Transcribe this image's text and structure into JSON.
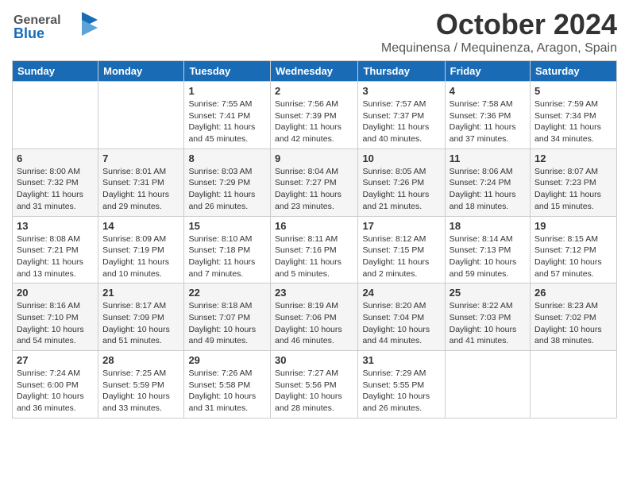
{
  "header": {
    "logo_general": "General",
    "logo_blue": "Blue",
    "main_title": "October 2024",
    "subtitle": "Mequinensa / Mequinenza, Aragon, Spain"
  },
  "days_of_week": [
    "Sunday",
    "Monday",
    "Tuesday",
    "Wednesday",
    "Thursday",
    "Friday",
    "Saturday"
  ],
  "weeks": [
    [
      {
        "day": "",
        "sunrise": "",
        "sunset": "",
        "daylight": ""
      },
      {
        "day": "",
        "sunrise": "",
        "sunset": "",
        "daylight": ""
      },
      {
        "day": "1",
        "sunrise": "Sunrise: 7:55 AM",
        "sunset": "Sunset: 7:41 PM",
        "daylight": "Daylight: 11 hours and 45 minutes."
      },
      {
        "day": "2",
        "sunrise": "Sunrise: 7:56 AM",
        "sunset": "Sunset: 7:39 PM",
        "daylight": "Daylight: 11 hours and 42 minutes."
      },
      {
        "day": "3",
        "sunrise": "Sunrise: 7:57 AM",
        "sunset": "Sunset: 7:37 PM",
        "daylight": "Daylight: 11 hours and 40 minutes."
      },
      {
        "day": "4",
        "sunrise": "Sunrise: 7:58 AM",
        "sunset": "Sunset: 7:36 PM",
        "daylight": "Daylight: 11 hours and 37 minutes."
      },
      {
        "day": "5",
        "sunrise": "Sunrise: 7:59 AM",
        "sunset": "Sunset: 7:34 PM",
        "daylight": "Daylight: 11 hours and 34 minutes."
      }
    ],
    [
      {
        "day": "6",
        "sunrise": "Sunrise: 8:00 AM",
        "sunset": "Sunset: 7:32 PM",
        "daylight": "Daylight: 11 hours and 31 minutes."
      },
      {
        "day": "7",
        "sunrise": "Sunrise: 8:01 AM",
        "sunset": "Sunset: 7:31 PM",
        "daylight": "Daylight: 11 hours and 29 minutes."
      },
      {
        "day": "8",
        "sunrise": "Sunrise: 8:03 AM",
        "sunset": "Sunset: 7:29 PM",
        "daylight": "Daylight: 11 hours and 26 minutes."
      },
      {
        "day": "9",
        "sunrise": "Sunrise: 8:04 AM",
        "sunset": "Sunset: 7:27 PM",
        "daylight": "Daylight: 11 hours and 23 minutes."
      },
      {
        "day": "10",
        "sunrise": "Sunrise: 8:05 AM",
        "sunset": "Sunset: 7:26 PM",
        "daylight": "Daylight: 11 hours and 21 minutes."
      },
      {
        "day": "11",
        "sunrise": "Sunrise: 8:06 AM",
        "sunset": "Sunset: 7:24 PM",
        "daylight": "Daylight: 11 hours and 18 minutes."
      },
      {
        "day": "12",
        "sunrise": "Sunrise: 8:07 AM",
        "sunset": "Sunset: 7:23 PM",
        "daylight": "Daylight: 11 hours and 15 minutes."
      }
    ],
    [
      {
        "day": "13",
        "sunrise": "Sunrise: 8:08 AM",
        "sunset": "Sunset: 7:21 PM",
        "daylight": "Daylight: 11 hours and 13 minutes."
      },
      {
        "day": "14",
        "sunrise": "Sunrise: 8:09 AM",
        "sunset": "Sunset: 7:19 PM",
        "daylight": "Daylight: 11 hours and 10 minutes."
      },
      {
        "day": "15",
        "sunrise": "Sunrise: 8:10 AM",
        "sunset": "Sunset: 7:18 PM",
        "daylight": "Daylight: 11 hours and 7 minutes."
      },
      {
        "day": "16",
        "sunrise": "Sunrise: 8:11 AM",
        "sunset": "Sunset: 7:16 PM",
        "daylight": "Daylight: 11 hours and 5 minutes."
      },
      {
        "day": "17",
        "sunrise": "Sunrise: 8:12 AM",
        "sunset": "Sunset: 7:15 PM",
        "daylight": "Daylight: 11 hours and 2 minutes."
      },
      {
        "day": "18",
        "sunrise": "Sunrise: 8:14 AM",
        "sunset": "Sunset: 7:13 PM",
        "daylight": "Daylight: 10 hours and 59 minutes."
      },
      {
        "day": "19",
        "sunrise": "Sunrise: 8:15 AM",
        "sunset": "Sunset: 7:12 PM",
        "daylight": "Daylight: 10 hours and 57 minutes."
      }
    ],
    [
      {
        "day": "20",
        "sunrise": "Sunrise: 8:16 AM",
        "sunset": "Sunset: 7:10 PM",
        "daylight": "Daylight: 10 hours and 54 minutes."
      },
      {
        "day": "21",
        "sunrise": "Sunrise: 8:17 AM",
        "sunset": "Sunset: 7:09 PM",
        "daylight": "Daylight: 10 hours and 51 minutes."
      },
      {
        "day": "22",
        "sunrise": "Sunrise: 8:18 AM",
        "sunset": "Sunset: 7:07 PM",
        "daylight": "Daylight: 10 hours and 49 minutes."
      },
      {
        "day": "23",
        "sunrise": "Sunrise: 8:19 AM",
        "sunset": "Sunset: 7:06 PM",
        "daylight": "Daylight: 10 hours and 46 minutes."
      },
      {
        "day": "24",
        "sunrise": "Sunrise: 8:20 AM",
        "sunset": "Sunset: 7:04 PM",
        "daylight": "Daylight: 10 hours and 44 minutes."
      },
      {
        "day": "25",
        "sunrise": "Sunrise: 8:22 AM",
        "sunset": "Sunset: 7:03 PM",
        "daylight": "Daylight: 10 hours and 41 minutes."
      },
      {
        "day": "26",
        "sunrise": "Sunrise: 8:23 AM",
        "sunset": "Sunset: 7:02 PM",
        "daylight": "Daylight: 10 hours and 38 minutes."
      }
    ],
    [
      {
        "day": "27",
        "sunrise": "Sunrise: 7:24 AM",
        "sunset": "Sunset: 6:00 PM",
        "daylight": "Daylight: 10 hours and 36 minutes."
      },
      {
        "day": "28",
        "sunrise": "Sunrise: 7:25 AM",
        "sunset": "Sunset: 5:59 PM",
        "daylight": "Daylight: 10 hours and 33 minutes."
      },
      {
        "day": "29",
        "sunrise": "Sunrise: 7:26 AM",
        "sunset": "Sunset: 5:58 PM",
        "daylight": "Daylight: 10 hours and 31 minutes."
      },
      {
        "day": "30",
        "sunrise": "Sunrise: 7:27 AM",
        "sunset": "Sunset: 5:56 PM",
        "daylight": "Daylight: 10 hours and 28 minutes."
      },
      {
        "day": "31",
        "sunrise": "Sunrise: 7:29 AM",
        "sunset": "Sunset: 5:55 PM",
        "daylight": "Daylight: 10 hours and 26 minutes."
      },
      {
        "day": "",
        "sunrise": "",
        "sunset": "",
        "daylight": ""
      },
      {
        "day": "",
        "sunrise": "",
        "sunset": "",
        "daylight": ""
      }
    ]
  ]
}
